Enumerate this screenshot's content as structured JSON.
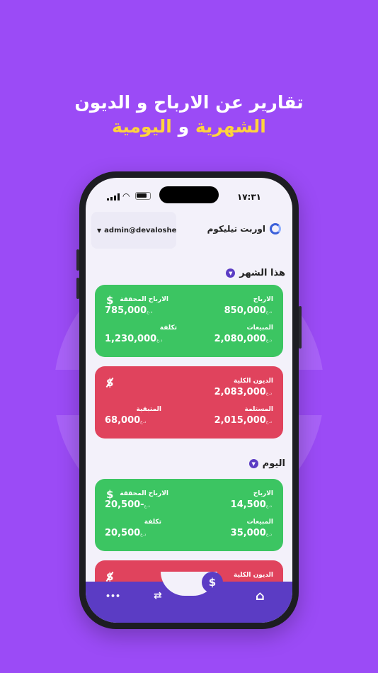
{
  "headline": {
    "line1": "تقارير عن الارباح و الديون",
    "line2_part1": "الشهرية",
    "line2_part2": " و ",
    "line2_part3": "اليومية"
  },
  "statusbar": {
    "time": "١٧:٣١"
  },
  "topbar": {
    "user": "admin@devaloshe",
    "company": "اوربت تيليكوم"
  },
  "currency": "د.ع",
  "month": {
    "title": "هذا الشهر",
    "profit_card": {
      "profits_label": "الارباح",
      "profits_value": "850,000",
      "realized_label": "الارباح المحققة",
      "realized_value": "785,000",
      "sales_label": "المبيعات",
      "sales_value": "2,080,000",
      "cost_label": "تكلفة",
      "cost_value": "1,230,000"
    },
    "debt_card": {
      "total_label": "الديون الكلية",
      "total_value": "2,083,000",
      "received_label": "المستلمة",
      "received_value": "2,015,000",
      "remaining_label": "المتبقية",
      "remaining_value": "68,000"
    }
  },
  "today": {
    "title": "اليوم",
    "profit_card": {
      "profits_label": "الارباح",
      "profits_value": "14,500",
      "realized_label": "الارباح المحققة",
      "realized_value": "-20,500",
      "sales_label": "المبيعات",
      "sales_value": "35,000",
      "cost_label": "تكلفة",
      "cost_value": "20,500"
    },
    "debt_card": {
      "total_label": "الديون الكلية"
    }
  },
  "nav": {
    "more": "•••",
    "exchange": "⇄",
    "dollar": "$",
    "home": "⌂"
  },
  "colors": {
    "background": "#9b4bf6",
    "accent": "#5b3cc4",
    "green": "#3cc562",
    "red": "#e0435d",
    "highlight": "#ffd33d"
  }
}
